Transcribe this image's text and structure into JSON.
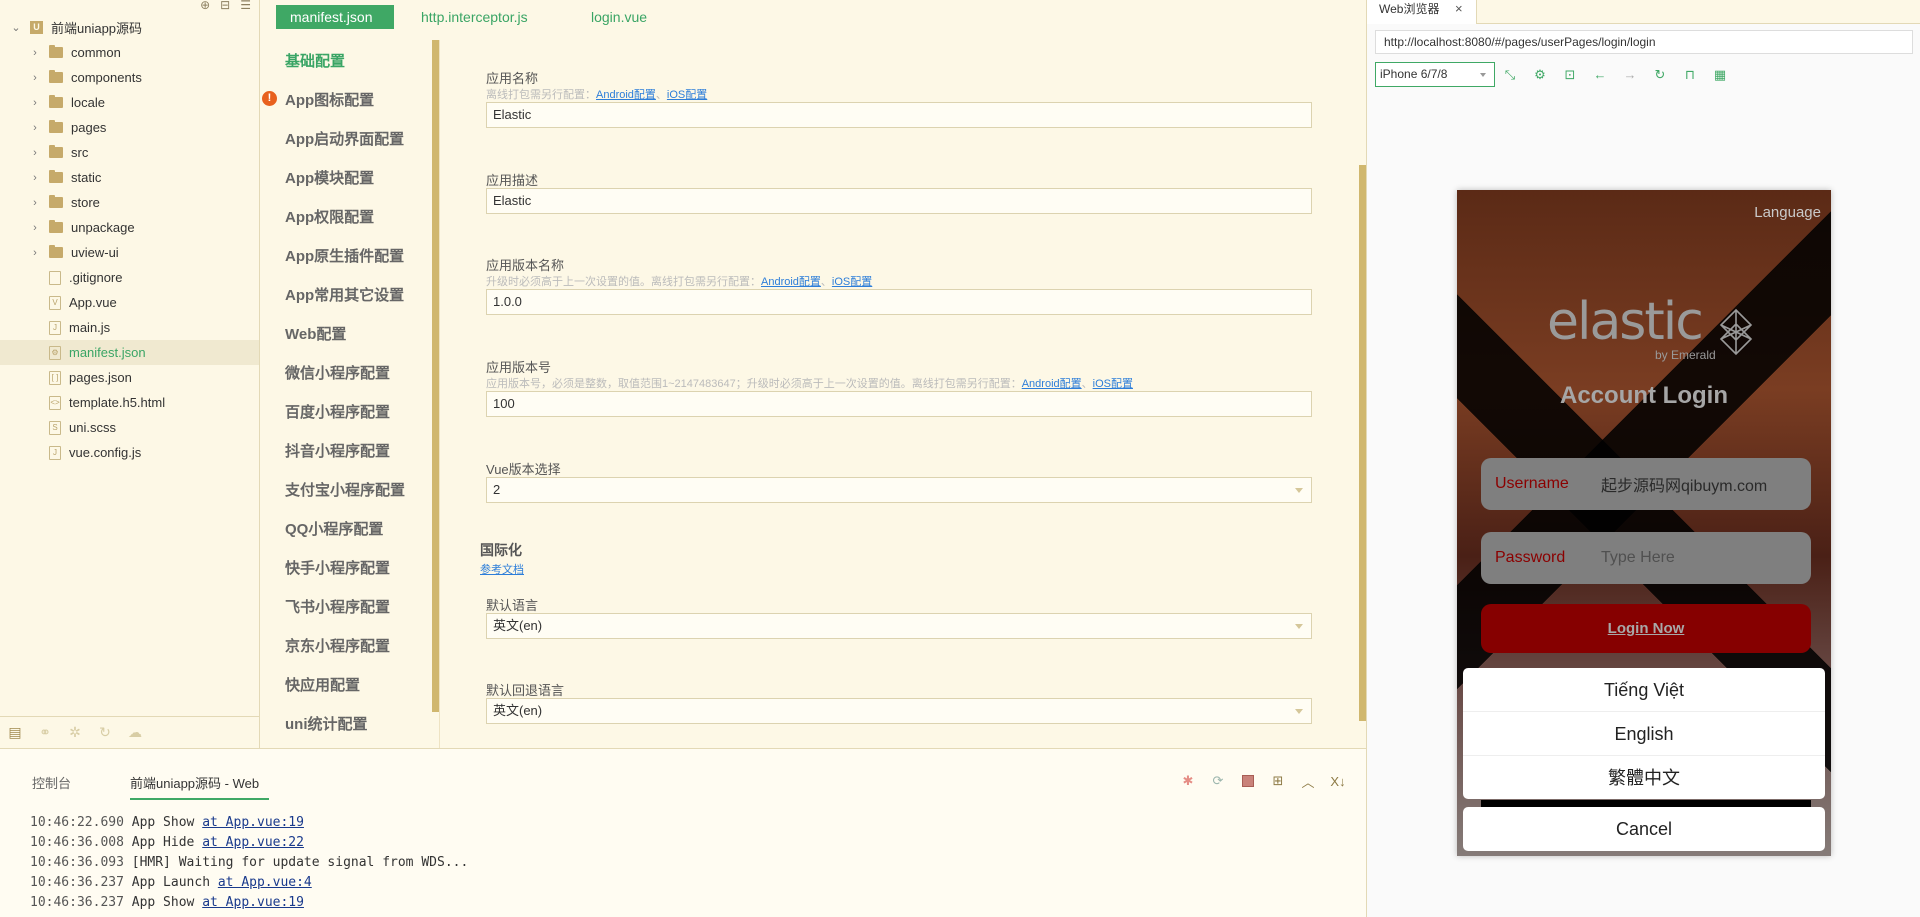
{
  "file_tree": {
    "toolbar_icons": [
      "locate-icon",
      "collapse-icon",
      "menu-icon"
    ],
    "project": "前端uniapp源码",
    "folders": [
      "common",
      "components",
      "locale",
      "pages",
      "src",
      "static",
      "store",
      "unpackage",
      "uview-ui"
    ],
    "files": [
      {
        "name": ".gitignore",
        "icon": "file-icon",
        "glyph": ""
      },
      {
        "name": "App.vue",
        "icon": "vue-file-icon",
        "glyph": "V"
      },
      {
        "name": "main.js",
        "icon": "js-file-icon",
        "glyph": "J"
      },
      {
        "name": "manifest.json",
        "icon": "manifest-file-icon",
        "glyph": "⚙",
        "selected": true
      },
      {
        "name": "pages.json",
        "icon": "json-file-icon",
        "glyph": "[ ]"
      },
      {
        "name": "template.h5.html",
        "icon": "html-file-icon",
        "glyph": "<>"
      },
      {
        "name": "uni.scss",
        "icon": "scss-file-icon",
        "glyph": "S"
      },
      {
        "name": "vue.config.js",
        "icon": "js-file-icon",
        "glyph": "J"
      }
    ],
    "bottom_tabs": [
      "project-manager-icon",
      "search-icon",
      "debug-icon",
      "git-icon",
      "cloud-icon"
    ]
  },
  "editor_tabs": [
    {
      "label": "manifest.json",
      "active": true
    },
    {
      "label": "http.interceptor.js",
      "active": false
    },
    {
      "label": "login.vue",
      "active": false
    }
  ],
  "manifest_nav": [
    {
      "label": "基础配置",
      "active": true
    },
    {
      "label": "App图标配置",
      "warning": true
    },
    {
      "label": "App启动界面配置"
    },
    {
      "label": "App模块配置"
    },
    {
      "label": "App权限配置"
    },
    {
      "label": "App原生插件配置"
    },
    {
      "label": "App常用其它设置"
    },
    {
      "label": "Web配置"
    },
    {
      "label": "微信小程序配置"
    },
    {
      "label": "百度小程序配置"
    },
    {
      "label": "抖音小程序配置"
    },
    {
      "label": "支付宝小程序配置"
    },
    {
      "label": "QQ小程序配置"
    },
    {
      "label": "快手小程序配置"
    },
    {
      "label": "飞书小程序配置"
    },
    {
      "label": "京东小程序配置"
    },
    {
      "label": "快应用配置"
    },
    {
      "label": "uni统计配置"
    }
  ],
  "form": {
    "app_name": {
      "label": "应用名称",
      "hint": "离线打包需另行配置：",
      "link1": "Android配置",
      "sep": "、",
      "link2": "iOS配置",
      "value": "Elastic"
    },
    "app_desc": {
      "label": "应用描述",
      "value": "Elastic"
    },
    "version_name": {
      "label": "应用版本名称",
      "hint": "升级时必须高于上一次设置的值。离线打包需另行配置：",
      "link1": "Android配置",
      "sep": "、",
      "link2": "iOS配置",
      "value": "1.0.0"
    },
    "version_code": {
      "label": "应用版本号",
      "hint": "应用版本号，必须是整数，取值范围1~2147483647；升级时必须高于上一次设置的值。离线打包需另行配置：",
      "link1": "Android配置",
      "sep": "、",
      "link2": "iOS配置",
      "value": "100"
    },
    "vue_version": {
      "label": "Vue版本选择",
      "value": "2"
    },
    "i18n": {
      "title": "国际化",
      "doc_link": "参考文档"
    },
    "default_locale": {
      "label": "默认语言",
      "value": "英文(en)"
    },
    "fallback_locale": {
      "label": "默认回退语言",
      "value": "英文(en)"
    }
  },
  "console": {
    "tabs": [
      {
        "label": "控制台",
        "active": false
      },
      {
        "label": "前端uniapp源码 - Web",
        "active": true
      }
    ],
    "toolbar_icons": [
      "debug-icon",
      "restart-icon",
      "stop-icon",
      "new-terminal-icon",
      "collapse-up-icon",
      "clear-icon"
    ],
    "logs": [
      {
        "ts": "10:46:22.690",
        "msg": "App Show ",
        "link": "at App.vue:19"
      },
      {
        "ts": "10:46:36.008",
        "msg": "App Hide ",
        "link": "at App.vue:22"
      },
      {
        "ts": "10:46:36.093",
        "msg": "[HMR] Waiting for update signal from WDS...",
        "link": ""
      },
      {
        "ts": "10:46:36.237",
        "msg": "App Launch ",
        "link": "at App.vue:4"
      },
      {
        "ts": "10:46:36.237",
        "msg": "App Show ",
        "link": "at App.vue:19"
      }
    ]
  },
  "browser": {
    "tab_label": "Web浏览器",
    "close_glyph": "×",
    "url": "http://localhost:8080/#/pages/userPages/login/login",
    "device": "iPhone 6/7/8",
    "toolbar_icons": [
      "rotate-icon",
      "settings-icon",
      "console-icon",
      "back-icon",
      "forward-icon",
      "reload-icon",
      "unlock-icon",
      "qrcode-icon"
    ]
  },
  "phone": {
    "language_link": "Language",
    "logo_text": "elastic",
    "logo_sub": "by Emerald",
    "title": "Account Login",
    "username_label": "Username",
    "username_value": "起步源码网qibuym.com",
    "password_label": "Password",
    "password_placeholder": "Type Here",
    "login_button": "Login Now",
    "language_options": [
      "Tiếng Việt",
      "English",
      "繁體中文"
    ],
    "cancel": "Cancel"
  },
  "colors": {
    "accent": "#3fa865",
    "scrollbar": "#d0b76e",
    "link": "#2d7ed9",
    "warning": "#e8611e",
    "login_button": "#860000"
  }
}
